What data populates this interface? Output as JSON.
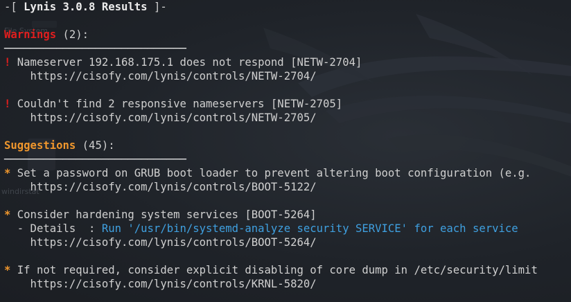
{
  "header": {
    "prefix": "-[ ",
    "title": "Lynis 3.0.8 Results",
    "suffix": " ]-"
  },
  "warnings": {
    "heading": "Warnings",
    "count": " (2):",
    "rule": "────────────────────────────",
    "items": [
      {
        "bullet": "!",
        "text": " Nameserver 192.168.175.1 does not respond [NETW-2704]",
        "url": "    https://cisofy.com/lynis/controls/NETW-2704/"
      },
      {
        "bullet": "!",
        "text": " Couldn't find 2 responsive nameservers [NETW-2705]",
        "url": "    https://cisofy.com/lynis/controls/NETW-2705/"
      }
    ]
  },
  "suggestions": {
    "heading": "Suggestions",
    "count": " (45):",
    "rule": "────────────────────────────",
    "items": [
      {
        "bullet": "*",
        "text": " Set a password on GRUB boot loader to prevent altering boot configuration (e.g.",
        "url": "    https://cisofy.com/lynis/controls/BOOT-5122/"
      },
      {
        "bullet": "*",
        "text": " Consider hardening system services [BOOT-5264]",
        "details_label": "  - Details  : ",
        "details_value": "Run '/usr/bin/systemd-analyze security SERVICE' for each service",
        "url": "    https://cisofy.com/lynis/controls/BOOT-5264/"
      },
      {
        "bullet": "*",
        "text": " If not required, consider explicit disabling of core dump in /etc/security/limit",
        "url": "    https://cisofy.com/lynis/controls/KRNL-5820/"
      }
    ]
  },
  "desktop": {
    "label_1": "File System",
    "label_2": "windirstat"
  },
  "colors": {
    "background": "#1e2229",
    "warning": "#e01e1e",
    "suggestion": "#f0972d",
    "detail_value": "#3fa0e0",
    "text": "#d8d8d8"
  }
}
